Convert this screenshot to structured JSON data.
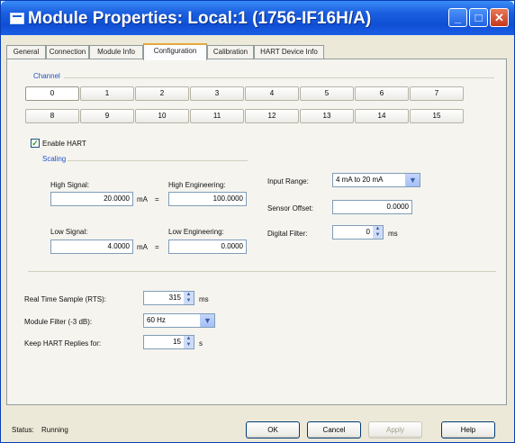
{
  "window": {
    "title": "Module Properties: Local:1 (1756-IF16H/A)"
  },
  "titlebar": {
    "minimize_glyph": "_",
    "maximize_glyph": "□",
    "close_glyph": "✕"
  },
  "tabs": [
    {
      "label": "General"
    },
    {
      "label": "Connection"
    },
    {
      "label": "Module Info"
    },
    {
      "label": "Configuration"
    },
    {
      "label": "Calibration"
    },
    {
      "label": "HART Device Info"
    }
  ],
  "active_tab": "Configuration",
  "channel": {
    "group_label": "Channel",
    "row1": [
      "0",
      "1",
      "2",
      "3",
      "4",
      "5",
      "6",
      "7"
    ],
    "row2": [
      "8",
      "9",
      "10",
      "11",
      "12",
      "13",
      "14",
      "15"
    ],
    "selected": "0"
  },
  "enable_hart": {
    "label": "Enable HART",
    "checked": true,
    "check_glyph": "✓"
  },
  "scaling": {
    "group_label": "Scaling",
    "high_signal": {
      "label": "High Signal:",
      "value": "20.0000",
      "unit": "mA"
    },
    "high_engineering": {
      "label": "High Engineering:",
      "value": "100.0000"
    },
    "low_signal": {
      "label": "Low Signal:",
      "value": "4.0000",
      "unit": "mA"
    },
    "low_engineering": {
      "label": "Low Engineering:",
      "value": "0.0000"
    },
    "equals": "="
  },
  "input_range": {
    "label": "Input Range:",
    "value": "4 mA to 20 mA"
  },
  "sensor_offset": {
    "label": "Sensor Offset:",
    "value": "0.0000"
  },
  "digital_filter": {
    "label": "Digital Filter:",
    "value": "0",
    "unit": "ms"
  },
  "rts": {
    "label": "Real Time Sample (RTS):",
    "value": "315",
    "unit": "ms"
  },
  "module_filter": {
    "label": "Module Filter (-3 dB):",
    "value": "60 Hz"
  },
  "keep_hart": {
    "label": "Keep HART Replies for:",
    "value": "15",
    "unit": "s"
  },
  "status": {
    "label": "Status:",
    "value": "Running"
  },
  "buttons": {
    "ok": "OK",
    "cancel": "Cancel",
    "apply": "Apply",
    "help": "Help"
  },
  "colors": {
    "title_bar": "#1b5fe0",
    "dialog_bg": "#ece9d8",
    "active_tab_accent": "#e6a93a",
    "group_label": "#2052c8"
  },
  "icons": {
    "window": "window-icon",
    "spin_up": "▲",
    "spin_down": "▼",
    "dropdown": "▼"
  }
}
